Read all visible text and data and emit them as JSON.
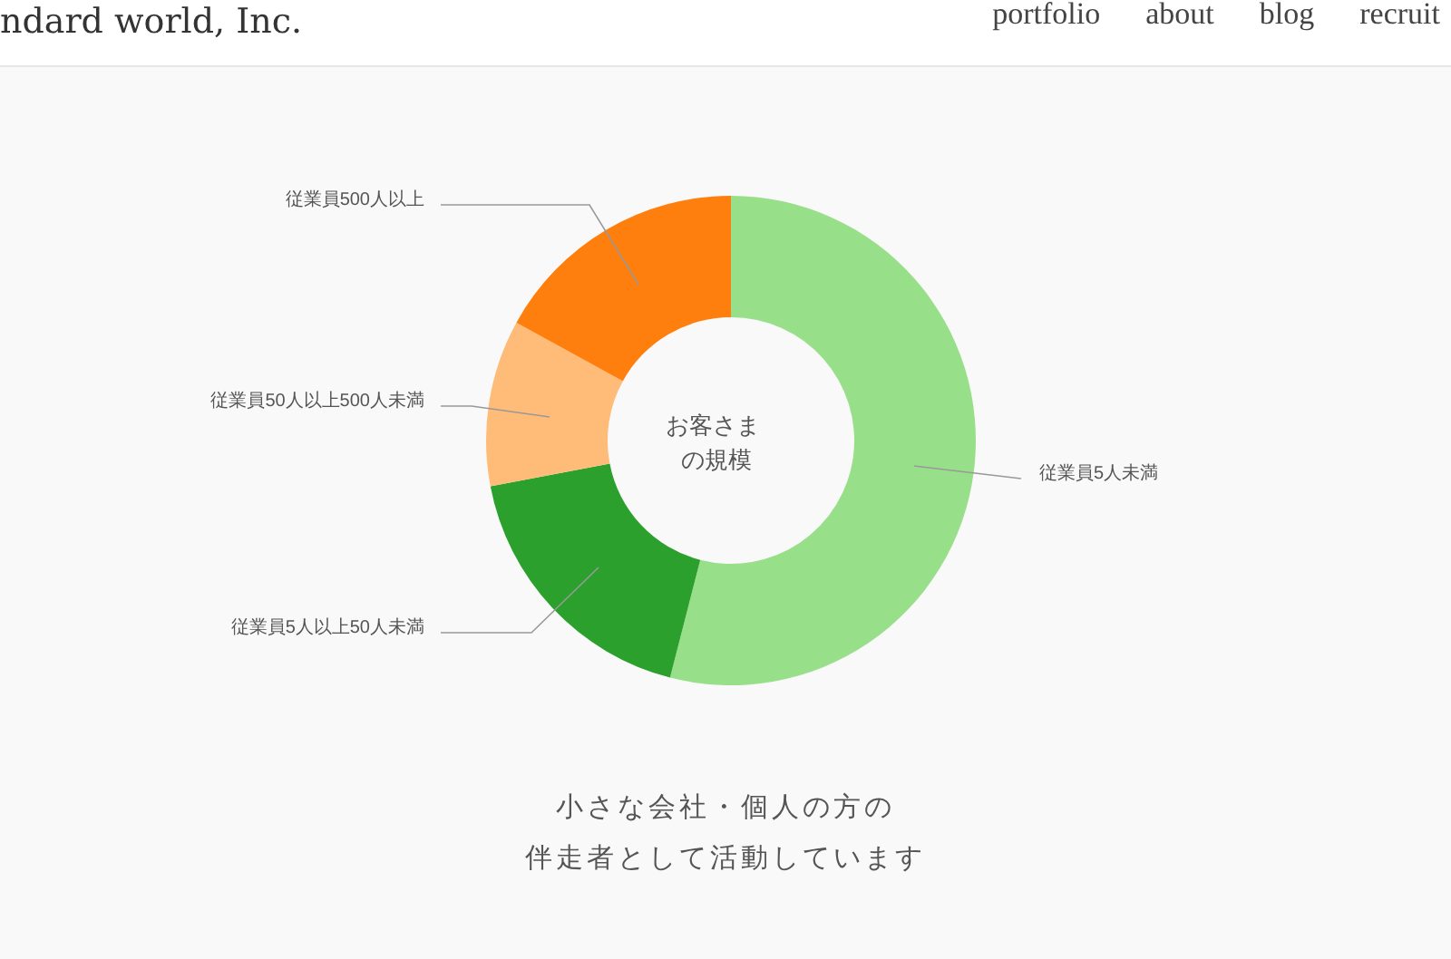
{
  "header": {
    "logo": "ndard world, Inc.",
    "nav": [
      "portfolio",
      "about",
      "blog",
      "recruit"
    ]
  },
  "chart": {
    "center_text": [
      "お客さま",
      "の規模"
    ],
    "chart_data": {
      "type": "donut",
      "categories": [
        "従業員5人未満",
        "従業員5人以上50人未満",
        "従業員50人以上500人未満",
        "従業員500人以上"
      ],
      "series": [
        {
          "values": [
            54,
            18,
            11,
            17
          ]
        }
      ],
      "colors": [
        "#98df8a",
        "#2ca02c",
        "#ffbb78",
        "#ff7f0e"
      ]
    }
  },
  "caption": [
    "小さな会社・個人の方の",
    "伴走者として活動しています"
  ]
}
